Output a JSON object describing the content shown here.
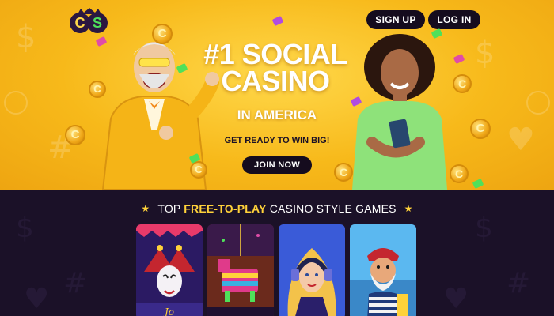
{
  "header": {
    "logo_text": "CS",
    "signup_label": "SIGN UP",
    "login_label": "LOG IN"
  },
  "hero": {
    "headline_line1": "#1 SOCIAL",
    "headline_line2": "CASINO",
    "subheadline": "IN AMERICA",
    "tagline": "GET READY TO WIN BIG!",
    "cta_label": "JOIN NOW"
  },
  "games_section": {
    "title_prefix": "TOP ",
    "title_highlight": "FREE-TO-PLAY",
    "title_suffix": " CASINO STYLE GAMES",
    "games": [
      {
        "icon": "jester-game-thumbnail"
      },
      {
        "icon": "pinata-game-thumbnail"
      },
      {
        "icon": "dj-girl-game-thumbnail"
      },
      {
        "icon": "sailor-game-thumbnail"
      }
    ]
  },
  "colors": {
    "hero_yellow": "#f7b91a",
    "button_dark": "#150c1e",
    "highlight_yellow": "#ffd23a",
    "lower_bg": "#1b1128",
    "logo_green": "#4fe05a"
  }
}
